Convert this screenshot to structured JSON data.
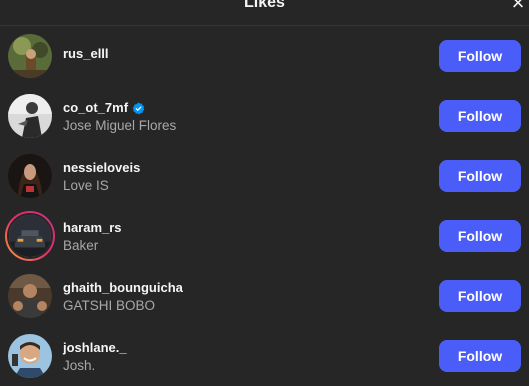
{
  "dialog": {
    "title": "Likes",
    "close_icon": "×"
  },
  "colors": {
    "background": "#262626",
    "follow_button": "#4a5df9",
    "secondary_text": "#a8a8a8",
    "verified_badge": "#0095f6"
  },
  "users": [
    {
      "username": "rus_elll",
      "full_name": "",
      "verified": false,
      "story_ring": false,
      "button": "Follow"
    },
    {
      "username": "co_ot_7mf",
      "full_name": "Jose Miguel Flores",
      "verified": true,
      "story_ring": false,
      "button": "Follow"
    },
    {
      "username": "nessieloveis",
      "full_name": "Love IS",
      "verified": false,
      "story_ring": false,
      "button": "Follow"
    },
    {
      "username": "haram_rs",
      "full_name": "Baker",
      "verified": false,
      "story_ring": true,
      "button": "Follow"
    },
    {
      "username": "ghaith_bounguicha",
      "full_name": "GATSHI BOBO",
      "verified": false,
      "story_ring": false,
      "button": "Follow"
    },
    {
      "username": "joshlane._",
      "full_name": "Josh.",
      "verified": false,
      "story_ring": false,
      "button": "Follow"
    }
  ]
}
